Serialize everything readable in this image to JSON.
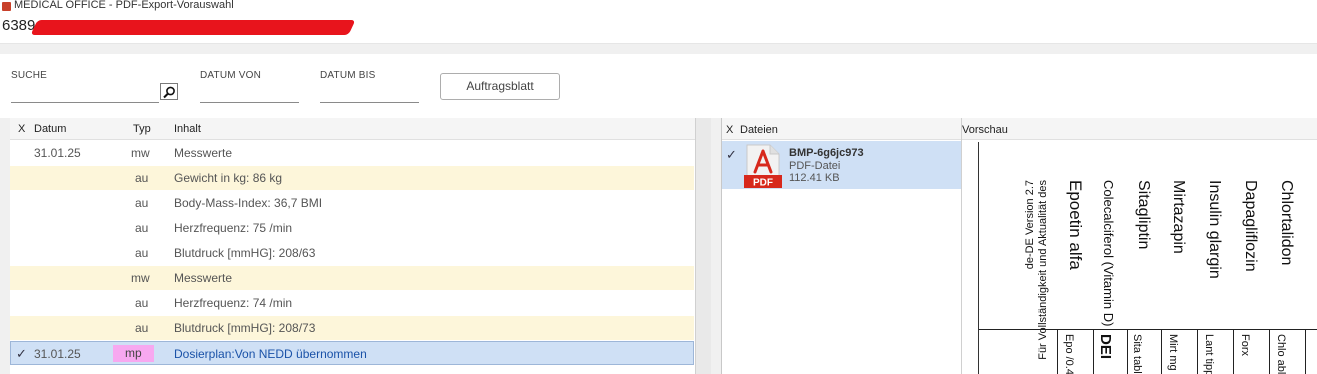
{
  "window": {
    "title": "MEDICAL OFFICE - PDF-Export-Vorauswahl"
  },
  "patient": {
    "info_visible": "6389"
  },
  "filter": {
    "search_label": "SUCHE",
    "date_from_label": "DATUM  VON",
    "date_to_label": "DATUM  BIS",
    "auftragsblatt_button": "Auftragsblatt"
  },
  "entries": {
    "headers": {
      "x": "X",
      "datum": "Datum",
      "typ": "Typ",
      "inhalt": "Inhalt"
    },
    "rows": [
      {
        "datum": "31.01.25",
        "typ": "mw",
        "inhalt": "Messwerte"
      },
      {
        "datum": "",
        "typ": "au",
        "inhalt": "Gewicht in kg: 86 kg"
      },
      {
        "datum": "",
        "typ": "au",
        "inhalt": "Body-Mass-Index: 36,7 BMI"
      },
      {
        "datum": "",
        "typ": "au",
        "inhalt": "Herzfrequenz: 75 /min"
      },
      {
        "datum": "",
        "typ": "au",
        "inhalt": "Blutdruck [mmHG]: 208/63"
      },
      {
        "datum": "",
        "typ": "mw",
        "inhalt": "Messwerte"
      },
      {
        "datum": "",
        "typ": "au",
        "inhalt": "Herzfrequenz: 74 /min"
      },
      {
        "datum": "",
        "typ": "au",
        "inhalt": "Blutdruck [mmHG]: 208/73"
      },
      {
        "check": "✓",
        "datum": "31.01.25",
        "typ": "mp",
        "inhalt": "Dosierplan:Von NEDD übernommen"
      }
    ]
  },
  "files": {
    "headers": {
      "x": "X",
      "dateien": "Dateien"
    },
    "item": {
      "check": "✓",
      "icon_label": "PDF",
      "name": "BMP-6g6jc973",
      "type": "PDF-Datei",
      "size": "112.41 KB"
    }
  },
  "preview": {
    "header": "Vorschau",
    "footer_line1": "Für Vollständigkeit und Aktualität des",
    "footer_line2": "de-DE Version 2.7",
    "drugs": [
      "Epoetin alfa",
      "Colecalciferol (Vitamin D)",
      "Sitagliptin",
      "Mirtazapin",
      "Insulin glargin",
      "Dapagliflozin",
      "Chlortalidon"
    ],
    "cells": [
      "Epo /0.4",
      "DEI",
      "Sita table",
      "Mirt mg",
      "Lant tipp",
      "Forx",
      "Chlo able"
    ]
  },
  "colors": {
    "row_highlight": "#fdf6da",
    "row_selected": "#cfe0f5",
    "typ_mp_badge": "#f7a8f0",
    "pdf_red": "#d7281c",
    "redaction": "#e8141c"
  }
}
